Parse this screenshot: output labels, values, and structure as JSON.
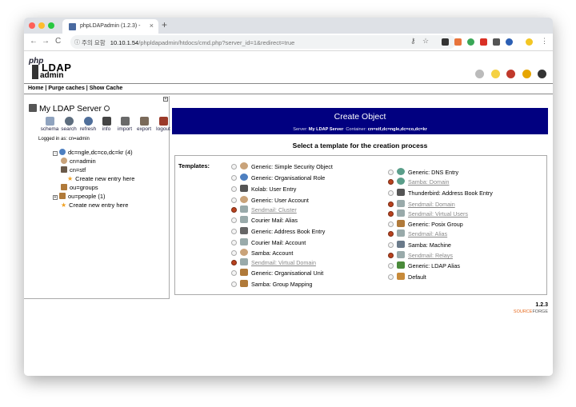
{
  "browser": {
    "tab_title": "phpLDAPadmin (1.2.3) -",
    "tab_close": "×",
    "new_tab": "+",
    "back": "←",
    "forward": "→",
    "reload": "C",
    "insecure_label": "주의 요함",
    "url_host": "10.10.1.54",
    "url_path": "/phpldapadmin/htdocs/cmd.php?server_id=1&redirect=true"
  },
  "logo": {
    "php": "php",
    "ldap": "LDAP",
    "admin": "admin"
  },
  "menu": {
    "home": "Home",
    "sep": " | ",
    "purge": "Purge caches",
    "show_cache": "Show Cache"
  },
  "server": {
    "name": "My LDAP Server",
    "logged_in": "Logged in as: cn=admin",
    "actions": [
      "schema",
      "search",
      "refresh",
      "info",
      "import",
      "export",
      "logout"
    ]
  },
  "tree": {
    "root": "dc=ngle,dc=co,dc=kr (4)",
    "items": [
      "cn=admin",
      "cn=stf",
      "Create new entry here",
      "ou=groups",
      "ou=people (1)",
      "Create new entry here"
    ]
  },
  "create_object": {
    "title": "Create Object",
    "server_label": "Server:",
    "server_value": "My LDAP Server",
    "container_label": "Container:",
    "container_value": "cn=stf,dc=ngle,dc=co,dc=kr",
    "select_title": "Select a template for the creation process",
    "templates_label": "Templates:",
    "left_templates": [
      "Generic: Simple Security Object",
      "Generic: Organisational Role",
      "Kolab: User Entry",
      "Generic: User Account",
      "Sendmail: Cluster",
      "Courier Mail: Alias",
      "Generic: Address Book Entry",
      "Courier Mail: Account",
      "Samba: Account",
      "Sendmail: Virtual Domain",
      "Generic: Organisational Unit",
      "Samba: Group Mapping"
    ],
    "right_templates": [
      "Generic: DNS Entry",
      "Samba: Domain",
      "Thunderbird: Address Book Entry",
      "Sendmail: Domain",
      "Sendmail: Virtual Users",
      "Generic: Posix Group",
      "Sendmail: Alias",
      "Samba: Machine",
      "Sendmail: Relays",
      "Generic: LDAP Alias",
      "Default"
    ]
  },
  "footer": {
    "version": "1.2.3",
    "sf_a": "SOURCE",
    "sf_b": "FORGE"
  },
  "colors": {
    "header_bg": "#010080",
    "disabled_radio": "#b8421e"
  }
}
